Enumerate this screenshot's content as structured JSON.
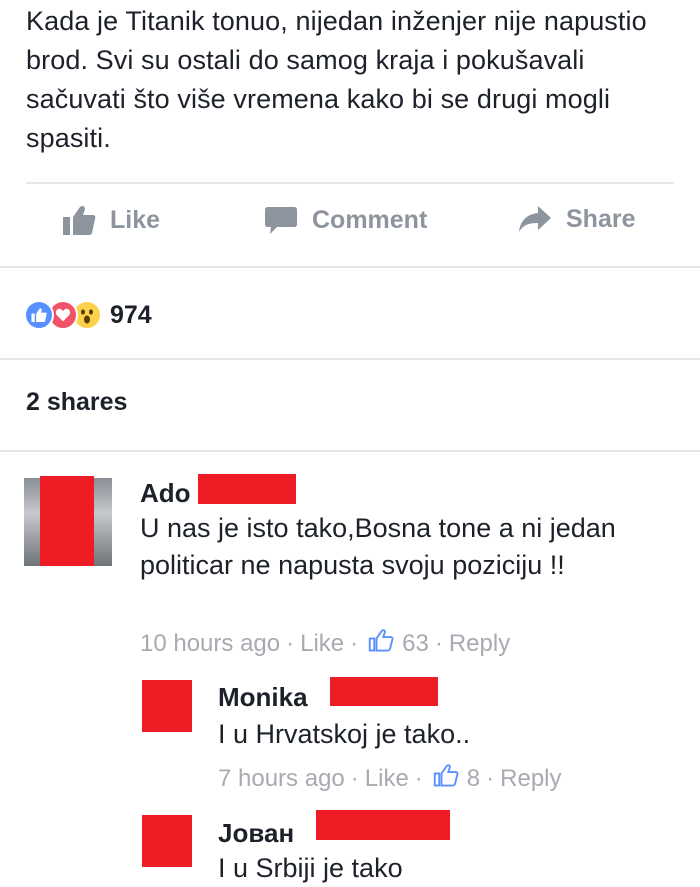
{
  "post": {
    "text": "Kada je Titanik tonuo, nijedan inženjer nije napustio brod. Svi su ostali do samog kraja i pokušavali sačuvati što više vremena kako bi se drugi mogli spasiti."
  },
  "actions": {
    "like_label": "Like",
    "comment_label": "Comment",
    "share_label": "Share"
  },
  "reactions": {
    "types": [
      "like",
      "love",
      "wow"
    ],
    "count": "974"
  },
  "shares": {
    "label": "2 shares"
  },
  "comments": [
    {
      "name": "Ado",
      "text": "U nas je isto tako,Bosna tone a ni jedan politicar ne napusta svoju poziciju !!",
      "time": "10 hours ago",
      "like_label": "Like",
      "likes": "63",
      "reply_label": "Reply"
    },
    {
      "name": "Monika",
      "text": "I u Hrvatskoj je tako..",
      "time": "7 hours ago",
      "like_label": "Like",
      "likes": "8",
      "reply_label": "Reply"
    },
    {
      "name": "Јован",
      "text": "I u Srbiji je tako"
    }
  ],
  "colors": {
    "redaction": "#ee1c25",
    "muted_text": "#8d949e",
    "meta_text": "#a7abb1",
    "like_blue": "#5890ff",
    "love_red": "#f25268",
    "wow_yellow": "#fcd24a"
  }
}
